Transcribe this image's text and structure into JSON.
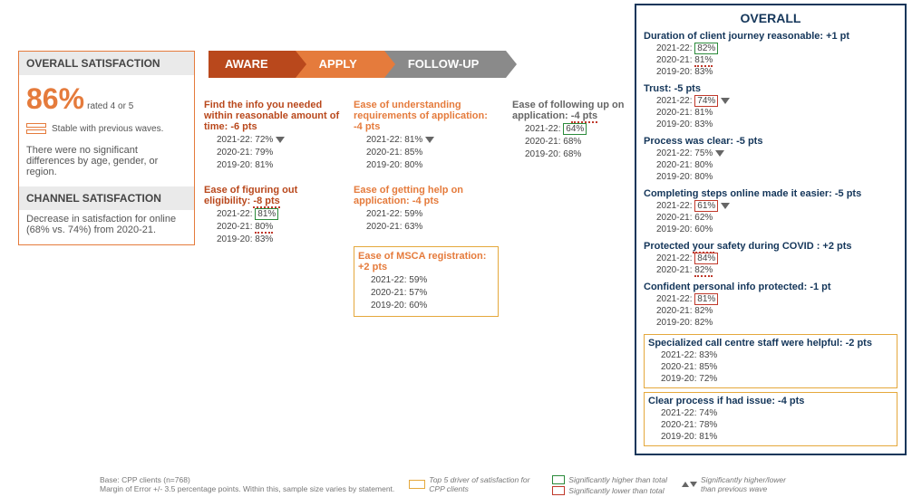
{
  "left": {
    "header1": "OVERALL SATISFACTION",
    "big_pct": "86%",
    "rated": "rated 4 or 5",
    "stable": "Stable with previous waves.",
    "note": "There were no significant differences by age, gender, or region.",
    "header2": "CHANNEL SATISFACTION",
    "channel_note": "Decrease in satisfaction for online (68% vs. 74%) from 2020-21."
  },
  "stages": {
    "aware": "AWARE",
    "apply": "APPLY",
    "follow": "FOLLOW-UP"
  },
  "aware": [
    {
      "title": "Find the info you needed within reasonable amount of time: -6 pts",
      "lines": [
        {
          "label": "2021-22:",
          "val": "72%",
          "flag": "none",
          "tri": true
        },
        {
          "label": "2020-21:",
          "val": "79%"
        },
        {
          "label": "2019-20:",
          "val": "81%"
        }
      ]
    },
    {
      "title_pre": "Ease of figuring out eligibility: ",
      "title_wave": "-8 pts",
      "lines": [
        {
          "label": "2021-22:",
          "val": "81%",
          "flag": "high"
        },
        {
          "label": "2020-21:",
          "val": "80%",
          "flag": "wave"
        },
        {
          "label": "2019-20:",
          "val": "83%"
        }
      ]
    }
  ],
  "apply": [
    {
      "title": "Ease of understanding requirements of application: -4 pts",
      "lines": [
        {
          "label": "2021-22:",
          "val": "81%",
          "tri": true
        },
        {
          "label": "2020-21:",
          "val": "85%"
        },
        {
          "label": "2019-20:",
          "val": "80%"
        }
      ]
    },
    {
      "title": "Ease of getting help on application: -4 pts",
      "lines": [
        {
          "label": "2021-22:",
          "val": "59%"
        },
        {
          "label": "2020-21:",
          "val": "63%"
        }
      ]
    },
    {
      "title": "Ease of MSCA registration: +2 pts",
      "yellow": true,
      "lines": [
        {
          "label": "2021-22:",
          "val": "59%"
        },
        {
          "label": "2020-21:",
          "val": "57%"
        },
        {
          "label": "2019-20:",
          "val": "60%"
        }
      ]
    }
  ],
  "follow": [
    {
      "title_pre": "Ease of following up on application: ",
      "title_wave": "-4 pts",
      "lines": [
        {
          "label": "2021-22:",
          "val": "64%",
          "flag": "high"
        },
        {
          "label": "2020-21:",
          "val": "68%"
        },
        {
          "label": "2019-20:",
          "val": "68%"
        }
      ]
    }
  ],
  "overall": {
    "title": "OVERALL",
    "items": [
      {
        "title": "Duration of client journey reasonable: +1 pt",
        "lines": [
          {
            "label": "2021-22:",
            "val": "82%",
            "flag": "high"
          },
          {
            "label": "2020-21:",
            "val": "81%",
            "flag": "wave"
          },
          {
            "label": "2019-20:",
            "val": "83%"
          }
        ]
      },
      {
        "title": "Trust: -5 pts",
        "lines": [
          {
            "label": "2021-22:",
            "val": "74%",
            "flag": "low",
            "tri": true
          },
          {
            "label": "2020-21:",
            "val": "81%"
          },
          {
            "label": "2019-20:",
            "val": "83%"
          }
        ]
      },
      {
        "title": "Process was clear: -5 pts",
        "lines": [
          {
            "label": "2021-22:",
            "val": "75%",
            "tri": true
          },
          {
            "label": "2020-21:",
            "val": "80%"
          },
          {
            "label": "2019-20:",
            "val": "80%"
          }
        ]
      },
      {
        "title": "Completing steps online made it easier: -5 pts",
        "lines": [
          {
            "label": "2021-22:",
            "val": "61%",
            "flag": "low",
            "tri": true
          },
          {
            "label": "2020-21:",
            "val": "62%"
          },
          {
            "label": "2019-20:",
            "val": "60%"
          }
        ]
      },
      {
        "title_pre": "Protected ",
        "title_wave": "your",
        "title_post": " safety during COVID : +2 pts",
        "lines": [
          {
            "label": "2021-22:",
            "val": "84%",
            "flag": "low"
          },
          {
            "label": "2020-21:",
            "val": "82%",
            "flag": "wave"
          }
        ]
      },
      {
        "title": "Confident personal info protected: -1 pt",
        "lines": [
          {
            "label": "2021-22:",
            "val": "81%",
            "flag": "low"
          },
          {
            "label": "2020-21:",
            "val": "82%"
          },
          {
            "label": "2019-20:",
            "val": "82%"
          }
        ]
      },
      {
        "title": "Specialized call centre staff were helpful: -2 pts",
        "yellow": true,
        "lines": [
          {
            "label": "2021-22:",
            "val": "83%"
          },
          {
            "label": "2020-21:",
            "val": "85%"
          },
          {
            "label": "2019-20:",
            "val": "72%"
          }
        ]
      },
      {
        "title": "Clear process if had issue: -4 pts",
        "yellow": true,
        "lines": [
          {
            "label": "2021-22:",
            "val": "74%"
          },
          {
            "label": "2020-21:",
            "val": "78%"
          },
          {
            "label": "2019-20:",
            "val": "81%"
          }
        ]
      }
    ]
  },
  "footer": {
    "base1": "Base: CPP clients (n=768)",
    "base2": "Margin of Error +/- 3.5 percentage points. Within this, sample size varies by statement.",
    "leg_yellow": "Top 5 driver of satisfaction for CPP clients",
    "leg_green": "Significantly higher than total",
    "leg_red": "Significantly lower than total",
    "leg_tri": "Significantly higher/lower than previous wave"
  }
}
